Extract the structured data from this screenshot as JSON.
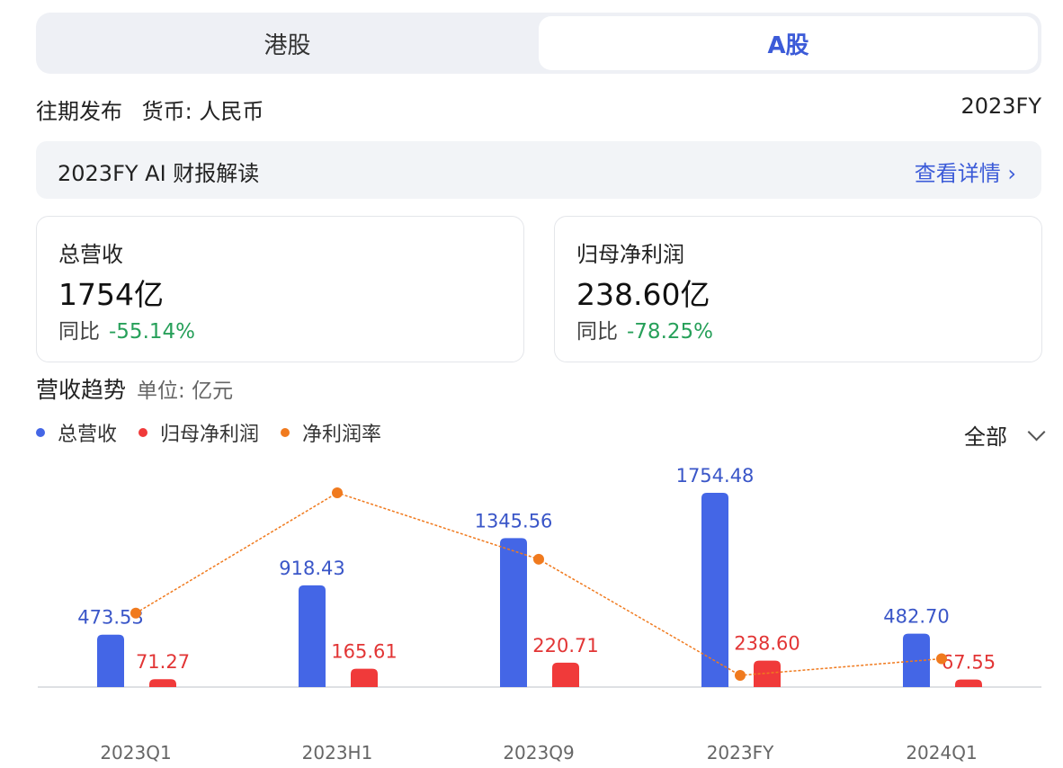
{
  "tabs": [
    {
      "label": "港股",
      "active": false
    },
    {
      "label": "A股",
      "active": true
    }
  ],
  "meta": {
    "past_releases": "往期发布",
    "currency": "货币: 人民币",
    "period": "2023FY"
  },
  "ai": {
    "title": "2023FY AI 财报解读",
    "link": "查看详情 ›"
  },
  "cards": [
    {
      "label": "总营收",
      "value": "1754亿",
      "yoy_label": "同比",
      "yoy_value": "-55.14%"
    },
    {
      "label": "归母净利润",
      "value": "238.60亿",
      "yoy_label": "同比",
      "yoy_value": "-78.25%"
    }
  ],
  "trend": {
    "title": "营收趋势",
    "unit": "单位: 亿元",
    "filter": "全部"
  },
  "colors": {
    "revenue": "#4466e6",
    "net_profit": "#f03a3a",
    "margin": "#f07a1e",
    "accent": "#3c5bd8",
    "negative": "#27a05a"
  },
  "chart_data": {
    "type": "bar",
    "categories": [
      "2023Q1",
      "2023H1",
      "2023Q9",
      "2023FY",
      "2024Q1"
    ],
    "series": [
      {
        "name": "总营收",
        "type": "bar",
        "values": [
          473.53,
          918.43,
          1345.56,
          1754.48,
          482.7
        ],
        "labels": [
          "473.53",
          "918.43",
          "1345.56",
          "1754.48",
          "482.70"
        ]
      },
      {
        "name": "归母净利润",
        "type": "bar",
        "values": [
          71.27,
          165.61,
          220.71,
          238.6,
          67.55
        ],
        "labels": [
          "71.27",
          "165.61",
          "220.71",
          "238.60",
          "67.55"
        ]
      },
      {
        "name": "净利润率",
        "type": "line",
        "values": [
          15.1,
          18.0,
          16.4,
          13.6,
          14.0
        ]
      }
    ],
    "ylim": [
      0,
      1800
    ],
    "grid": false,
    "legend": "top-left"
  }
}
